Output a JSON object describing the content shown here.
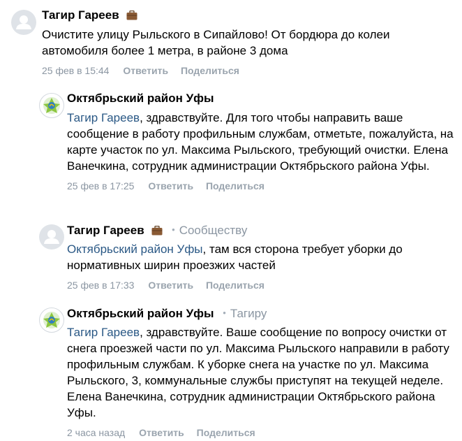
{
  "comments": [
    {
      "author": "Тагир Гареев",
      "reply_to": "",
      "mention": "",
      "text": "Очистите улицу Рыльского в Сипайлово! От бордюра до колеи автомобиля более 1 метра, в районе 3 дома",
      "time": "25 фев в 15:44",
      "reply_label": "Ответить",
      "share_label": "Поделиться"
    },
    {
      "author": "Октябрьский район Уфы",
      "reply_to": "",
      "mention": "Тагир Гареев",
      "text": ", здравствуйте. Для того чтобы направить ваше сообщение в работу профильным службам, отметьте, пожалуйста, на карте участок по ул. Максима Рыльского, требующий очистки. Елена Ванечкина, сотрудник администрации Октябрьского района Уфы.",
      "time": "25 фев в 17:25",
      "reply_label": "Ответить",
      "share_label": "Поделиться"
    },
    {
      "author": "Тагир Гареев",
      "reply_to": "Сообществу",
      "mention": "Октябрьский район Уфы",
      "text": ", там вся сторона требует уборки до нормативных ширин проезжих частей",
      "time": "25 фев в 17:33",
      "reply_label": "Ответить",
      "share_label": "Поделиться"
    },
    {
      "author": "Октябрьский район Уфы",
      "reply_to": "Тагиру",
      "mention": "Тагир Гареев",
      "text": ", здравствуйте. Ваше сообщение по вопросу очистки от снега проезжей части по ул. Максима Рыльского направили в работу профильным службам. К уборке снега на участке по ул. Максима Рыльского, 3, коммунальные службы приступят на текущей неделе. Елена Ванечкина, сотрудник администрации Октябрьского района Уфы.",
      "time": "2 часа назад",
      "reply_label": "Ответить",
      "share_label": "Поделиться"
    }
  ],
  "colors": {
    "mention": "#2a5885",
    "meta": "#8b96a2",
    "avatar_user_bg": "#dfe3e8"
  }
}
